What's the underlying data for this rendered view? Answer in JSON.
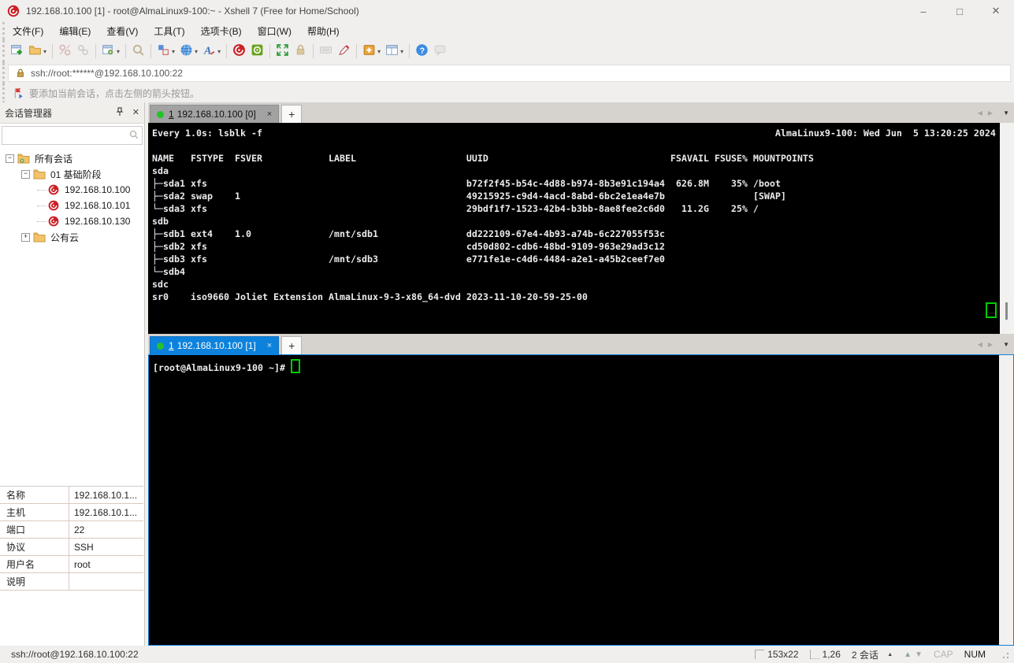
{
  "window": {
    "title": "192.168.10.100 [1] - root@AlmaLinux9-100:~ - Xshell 7 (Free for Home/School)",
    "controls": {
      "minimize": "–",
      "maximize": "□",
      "close": "✕"
    }
  },
  "menu": {
    "items": [
      "文件(F)",
      "编辑(E)",
      "查看(V)",
      "工具(T)",
      "选项卡(B)",
      "窗口(W)",
      "帮助(H)"
    ]
  },
  "toolbar": {
    "buttons": [
      "new-session",
      "open-folder",
      "disconnect",
      "reconnect",
      "session-properties",
      "find",
      "compose",
      "web",
      "font",
      "xshell",
      "xftp",
      "fullscreen",
      "lock",
      "keyboard",
      "highlight",
      "tab-new",
      "layout",
      "help",
      "message"
    ]
  },
  "address_bar": {
    "value": "ssh://root:******@192.168.10.100:22"
  },
  "info_bar": {
    "text": "要添加当前会话，点击左侧的箭头按钮。"
  },
  "session_manager": {
    "title": "会话管理器",
    "search_placeholder": "",
    "tree": [
      {
        "label": "所有会话"
      },
      {
        "label": "01 基础阶段"
      },
      {
        "label": "192.168.10.100"
      },
      {
        "label": "192.168.10.101"
      },
      {
        "label": "192.168.10.130"
      },
      {
        "label": "公有云"
      }
    ],
    "properties": [
      {
        "label": "名称",
        "value": "192.168.10.1..."
      },
      {
        "label": "主机",
        "value": "192.168.10.1..."
      },
      {
        "label": "端口",
        "value": "22"
      },
      {
        "label": "协议",
        "value": "SSH"
      },
      {
        "label": "用户名",
        "value": "root"
      },
      {
        "label": "说明",
        "value": ""
      }
    ]
  },
  "terminal1": {
    "tab": {
      "num": "1",
      "label": "192.168.10.100 [0]",
      "close": "×"
    },
    "watch_left": "Every 1.0s: lsblk -f",
    "watch_right": "AlmaLinux9-100: Wed Jun  5 13:20:25 2024",
    "width": 153,
    "cols": [
      0,
      7,
      15,
      32,
      57,
      94,
      102,
      109
    ],
    "right_align": {
      "5": 100,
      "6": 107
    },
    "header": [
      "NAME",
      "FSTYPE",
      "FSVER",
      "LABEL",
      "UUID",
      "FSAVAIL",
      "FSUSE%",
      "MOUNTPOINTS"
    ],
    "rows": [
      [
        "sda",
        "",
        "",
        "",
        "",
        "",
        "",
        ""
      ],
      [
        "├─sda1",
        "xfs",
        "",
        "",
        "b72f2f45-b54c-4d88-b974-8b3e91c194a4",
        "626.8M",
        "35%",
        "/boot"
      ],
      [
        "├─sda2",
        "swap",
        "1",
        "",
        "49215925-c9d4-4acd-8abd-6bc2e1ea4e7b",
        "",
        "",
        "[SWAP]"
      ],
      [
        "└─sda3",
        "xfs",
        "",
        "",
        "29bdf1f7-1523-42b4-b3bb-8ae8fee2c6d0",
        "11.2G",
        "25%",
        "/"
      ],
      [
        "sdb",
        "",
        "",
        "",
        "",
        "",
        "",
        ""
      ],
      [
        "├─sdb1",
        "ext4",
        "1.0",
        "/mnt/sdb1",
        "dd222109-67e4-4b93-a74b-6c227055f53c",
        "",
        "",
        ""
      ],
      [
        "├─sdb2",
        "xfs",
        "",
        "",
        "cd50d802-cdb6-48bd-9109-963e29ad3c12",
        "",
        "",
        ""
      ],
      [
        "├─sdb3",
        "xfs",
        "",
        "/mnt/sdb3",
        "e771fe1e-c4d6-4484-a2e1-a45b2ceef7e0",
        "",
        "",
        ""
      ],
      [
        "└─sdb4",
        "",
        "",
        "",
        "",
        "",
        "",
        ""
      ],
      [
        "sdc",
        "",
        "",
        "",
        "",
        "",
        "",
        ""
      ],
      [
        "sr0",
        "iso9660",
        "Joliet Extension",
        "AlmaLinux-9-3-x86_64-dvd",
        "2023-11-10-20-59-25-00",
        "",
        "",
        ""
      ]
    ]
  },
  "terminal2": {
    "tab": {
      "num": "1",
      "label": "192.168.10.100 [1]",
      "close": "×"
    },
    "prompt": "[root@AlmaLinux9-100 ~]# "
  },
  "status_bar": {
    "left": "ssh://root@192.168.10.100:22",
    "size": "153x22",
    "cursor_pos": "1,26",
    "sessions": "2 会话",
    "cap": "CAP",
    "num": "NUM"
  },
  "colors": {
    "active_tab_blue": "#0d82dc",
    "terminal_green": "#00cc00",
    "session_red": "#cc2027",
    "folder_tan": "#f2c36b",
    "inactive_tab_gray": "#a2a2a2"
  }
}
